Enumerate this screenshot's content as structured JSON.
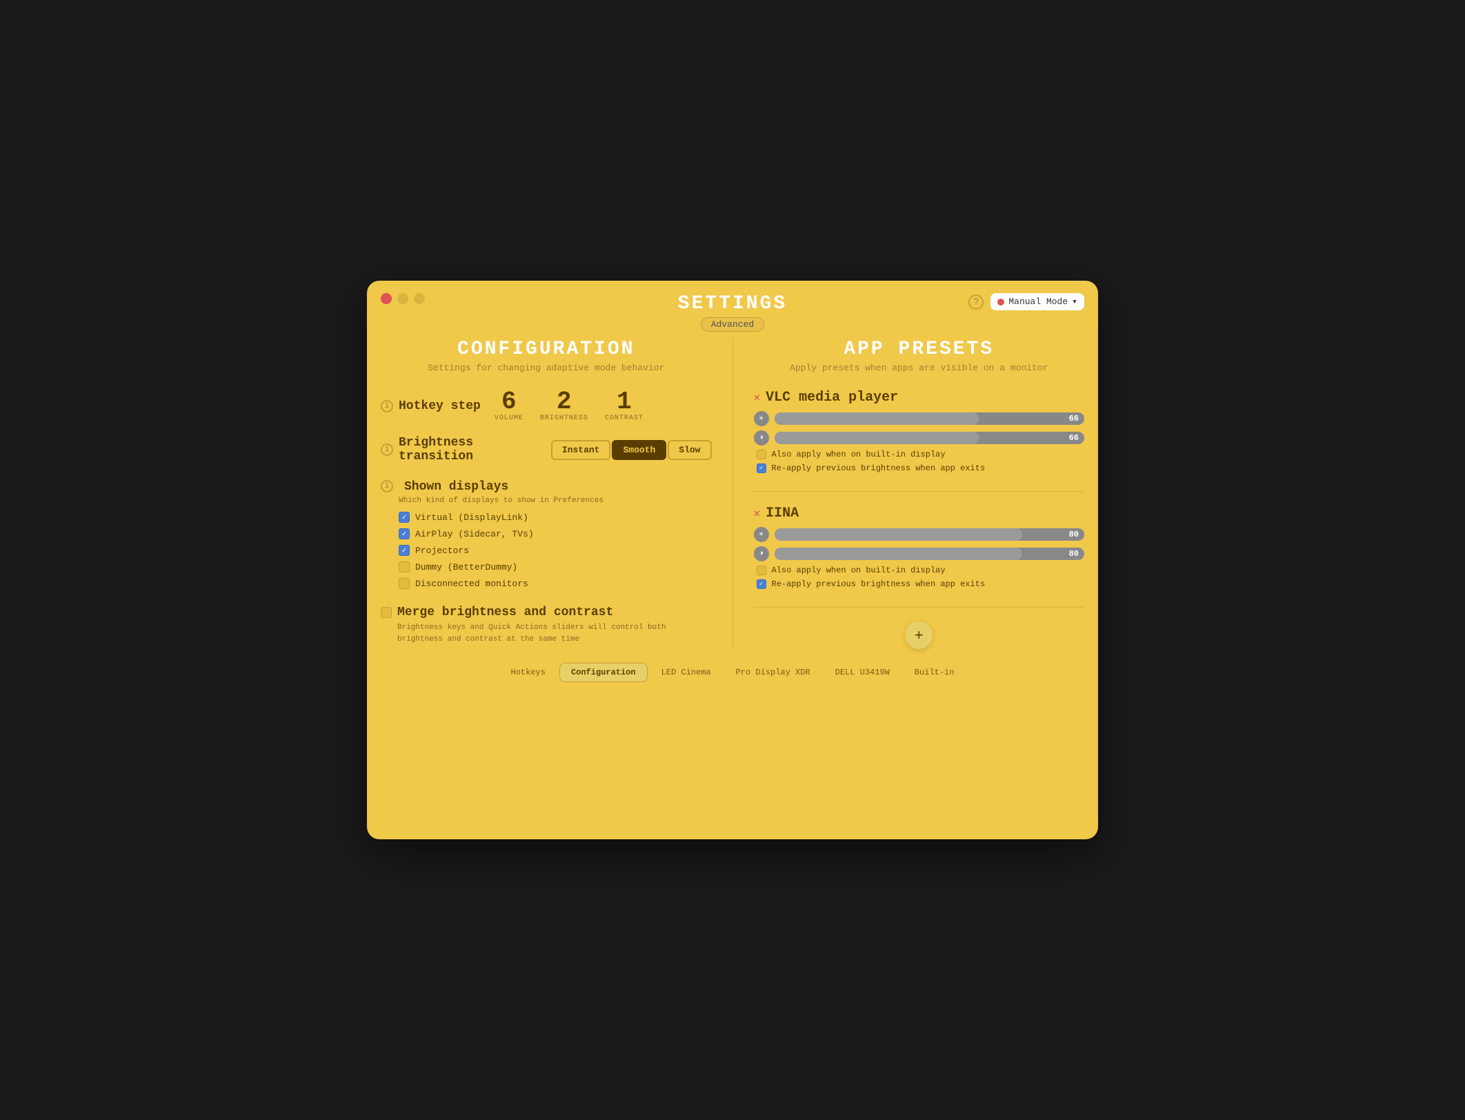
{
  "window": {
    "title": "SETTINGS",
    "subtitle": "Advanced"
  },
  "header": {
    "help_label": "?",
    "mode_label": "Manual Mode"
  },
  "left_panel": {
    "section_title": "CONFIGURATION",
    "section_subtitle": "Settings for changing adaptive mode behavior",
    "hotkey_step": {
      "label": "Hotkey step",
      "values": [
        {
          "number": "6",
          "sublabel": "VOLUME"
        },
        {
          "number": "2",
          "sublabel": "BRIGHTNESS"
        },
        {
          "number": "1",
          "sublabel": "CONTRAST"
        }
      ]
    },
    "brightness_transition": {
      "label": "Brightness transition",
      "options": [
        "Instant",
        "Smooth",
        "Slow"
      ],
      "active": "Smooth"
    },
    "shown_displays": {
      "label": "Shown displays",
      "sublabel": "Which kind of displays to show in Preferences",
      "checkboxes": [
        {
          "label": "Virtual (DisplayLink)",
          "checked": true
        },
        {
          "label": "AirPlay (Sidecar, TVs)",
          "checked": true
        },
        {
          "label": "Projectors",
          "checked": true
        },
        {
          "label": "Dummy (BetterDummy)",
          "checked": false
        },
        {
          "label": "Disconnected monitors",
          "checked": false
        }
      ]
    },
    "merge_section": {
      "checked": false,
      "label": "Merge brightness and contrast",
      "sublabel": "Brightness keys and Quick Actions sliders will\ncontrol both brightness and contrast at the same time"
    }
  },
  "right_panel": {
    "section_title": "APP  PRESETS",
    "section_subtitle": "Apply presets when apps are visible on a monitor",
    "apps": [
      {
        "name": "VLC media player",
        "brightness_value": 66,
        "brightness_pct": 66,
        "contrast_value": 66,
        "contrast_pct": 66,
        "also_apply": false,
        "also_apply_label": "Also apply when on built-in display",
        "reapply": true,
        "reapply_label": "Re-apply previous brightness when app exits"
      },
      {
        "name": "IINA",
        "brightness_value": 80,
        "brightness_pct": 80,
        "contrast_value": 80,
        "contrast_pct": 80,
        "also_apply": false,
        "also_apply_label": "Also apply when on built-in display",
        "reapply": true,
        "reapply_label": "Re-apply previous brightness when app exits"
      }
    ],
    "add_button_label": "+"
  },
  "bottom_tabs": {
    "items": [
      {
        "label": "Hotkeys",
        "active": false
      },
      {
        "label": "Configuration",
        "active": true
      },
      {
        "label": "LED Cinema",
        "active": false
      },
      {
        "label": "Pro Display XDR",
        "active": false
      },
      {
        "label": "DELL U3419W",
        "active": false
      },
      {
        "label": "Built-in",
        "active": false
      }
    ]
  }
}
